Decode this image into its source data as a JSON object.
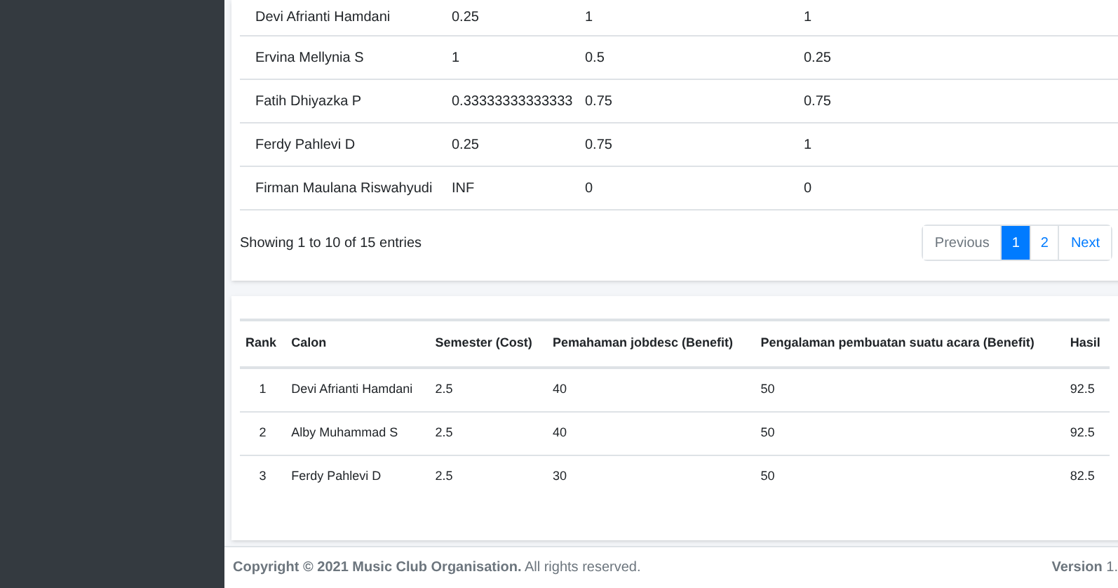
{
  "scores_table": {
    "rows": [
      {
        "cells": [
          "Devi Afrianti Hamdani",
          "0.25",
          "1",
          "1"
        ]
      },
      {
        "cells": [
          "Ervina Mellynia S",
          "1",
          "0.5",
          "0.25"
        ]
      },
      {
        "cells": [
          "Fatih Dhiyazka P",
          "0.33333333333333",
          "0.75",
          "0.75"
        ]
      },
      {
        "cells": [
          "Ferdy Pahlevi D",
          "0.25",
          "0.75",
          "1"
        ]
      },
      {
        "cells": [
          "Firman Maulana Riswahyudi",
          "INF",
          "0",
          "0"
        ]
      }
    ],
    "info": "Showing 1 to 10 of 15 entries",
    "pagination": [
      {
        "label": "Previous",
        "kind": "nav",
        "disabled": true
      },
      {
        "label": "1",
        "kind": "page",
        "selected": true
      },
      {
        "label": "2",
        "kind": "page",
        "selected": false
      },
      {
        "label": "Next",
        "kind": "nav",
        "disabled": false
      }
    ]
  },
  "ranking_table": {
    "columns": [
      "Rank",
      "Calon",
      "Semester (Cost)",
      "Pemahaman jobdesc (Benefit)",
      "Pengalaman pembuatan suatu acara (Benefit)",
      "Hasil"
    ],
    "rows": [
      {
        "cells": [
          "1",
          "Devi Afrianti Hamdani",
          "2.5",
          "40",
          "50",
          "92.5"
        ]
      },
      {
        "cells": [
          "2",
          "Alby Muhammad S",
          "2.5",
          "40",
          "50",
          "92.5"
        ]
      },
      {
        "cells": [
          "3",
          "Ferdy Pahlevi D",
          "2.5",
          "30",
          "50",
          "82.5"
        ]
      }
    ]
  },
  "footer": {
    "copyright": "**Copyright © 2021 Music Club Organisation.** All rights reserved.",
    "version": "**Version** 1."
  }
}
